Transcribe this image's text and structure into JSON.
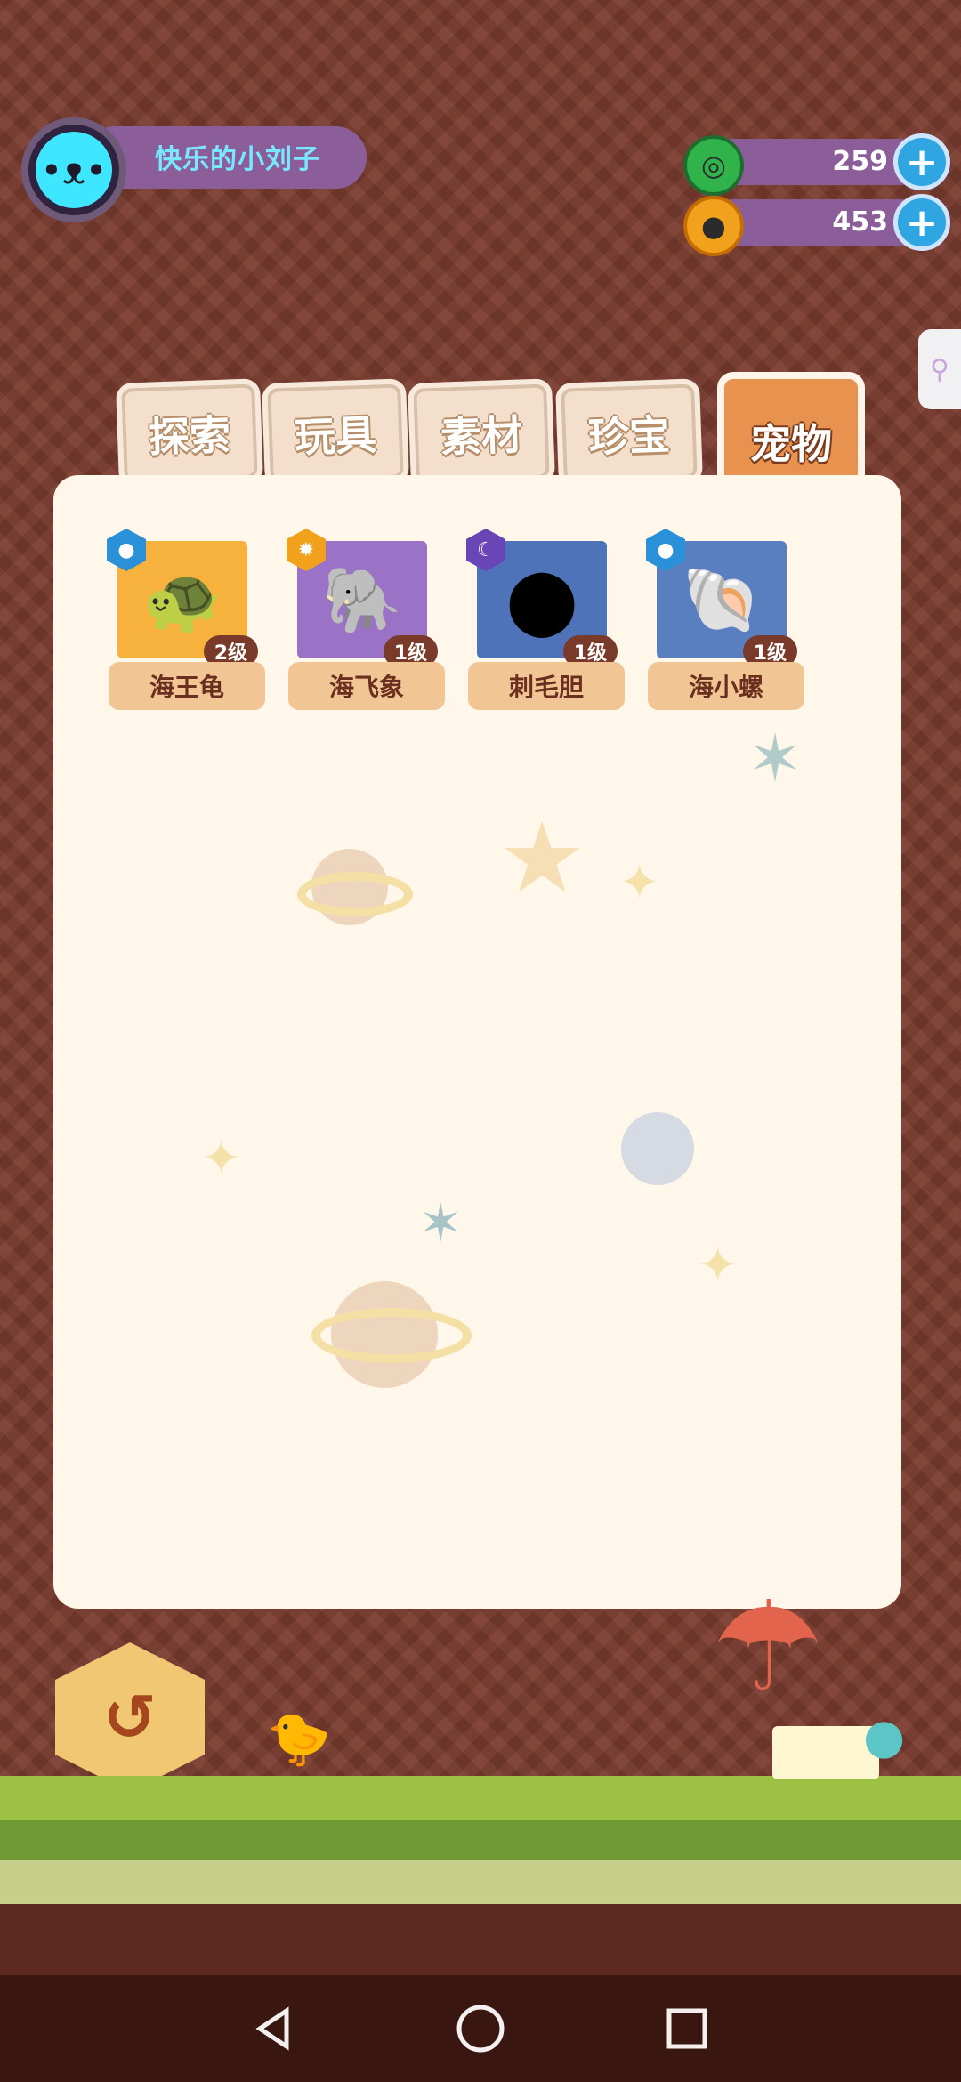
{
  "profile": {
    "name": "快乐的小刘子"
  },
  "currency": [
    {
      "icon": "donut-icon",
      "value": "259",
      "color": "#2fb34a"
    },
    {
      "icon": "planet-coin-icon",
      "value": "453",
      "color": "#f1a11c"
    }
  ],
  "tabs": [
    {
      "label": "探索",
      "active": false
    },
    {
      "label": "玩具",
      "active": false
    },
    {
      "label": "素材",
      "active": false
    },
    {
      "label": "珍宝",
      "active": false
    },
    {
      "label": "宠物",
      "active": true
    }
  ],
  "pets": [
    {
      "name": "海王龟",
      "level": "2级",
      "element": "water-drop-icon",
      "bg": "#f6b23c"
    },
    {
      "name": "海飞象",
      "level": "1级",
      "element": "sun-icon",
      "bg": "#9b73c6"
    },
    {
      "name": "刺毛胆",
      "level": "1级",
      "element": "moon-icon",
      "bg": "#4e73b8"
    },
    {
      "name": "海小螺",
      "level": "1级",
      "element": "water-drop-icon",
      "bg": "#5a7fc0"
    }
  ],
  "back_button": {
    "label": "返回"
  },
  "colors": {
    "accent": "#e8924f",
    "panel": "#fff7ea",
    "background": "#7a3b2e"
  }
}
